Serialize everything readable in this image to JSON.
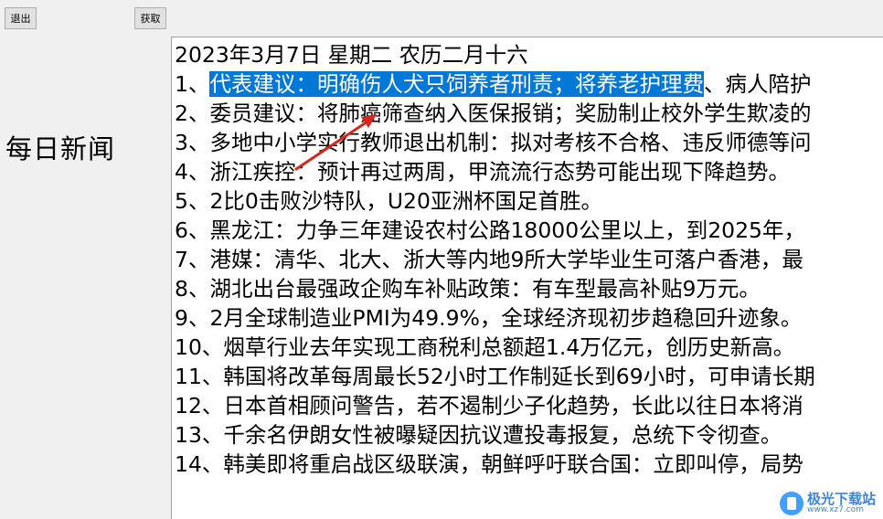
{
  "toolbar": {
    "exit_label": "退出",
    "fetch_label": "获取"
  },
  "sidebar": {
    "title": "每日新闻"
  },
  "news": {
    "date_line": "2023年3月7日 星期二 农历二月十六",
    "item1_prefix": "1、",
    "item1_selected": "代表建议：明确伤人犬只饲养者刑责；将养老护理费",
    "item1_rest": "、病人陪护",
    "items": [
      "2、委员建议：将肺癌筛查纳入医保报销；奖励制止校外学生欺凌的",
      "3、多地中小学实行教师退出机制：拟对考核不合格、违反师德等问",
      "4、浙江疾控：预计再过两周，甲流流行态势可能出现下降趋势。",
      "5、2比0击败沙特队，U20亚洲杯国足首胜。",
      "6、黑龙江：力争三年建设农村公路18000公里以上，到2025年，",
      "7、港媒：清华、北大、浙大等内地9所大学毕业生可落户香港，最",
      "8、湖北出台最强政企购车补贴政策：有车型最高补贴9万元。",
      "9、2月全球制造业PMI为49.9%，全球经济现初步趋稳回升迹象。",
      "10、烟草行业去年实现工商税利总额超1.4万亿元，创历史新高。",
      "11、韩国将改革每周最长52小时工作制延长到69小时，可申请长期",
      "12、日本首相顾问警告，若不遏制少子化趋势，长此以往日本将消",
      "13、千余名伊朗女性被曝疑因抗议遭投毒报复，总统下令彻查。",
      "14、韩美即将重启战区级联演，朝鲜呼吁联合国：立即叫停，局势"
    ]
  },
  "watermark": {
    "main": "极光下载站",
    "sub": "www.xz7.com"
  },
  "colors": {
    "selection": "#0078d7",
    "arrow": "#d9251c",
    "window_bg": "#f0f0f0"
  }
}
